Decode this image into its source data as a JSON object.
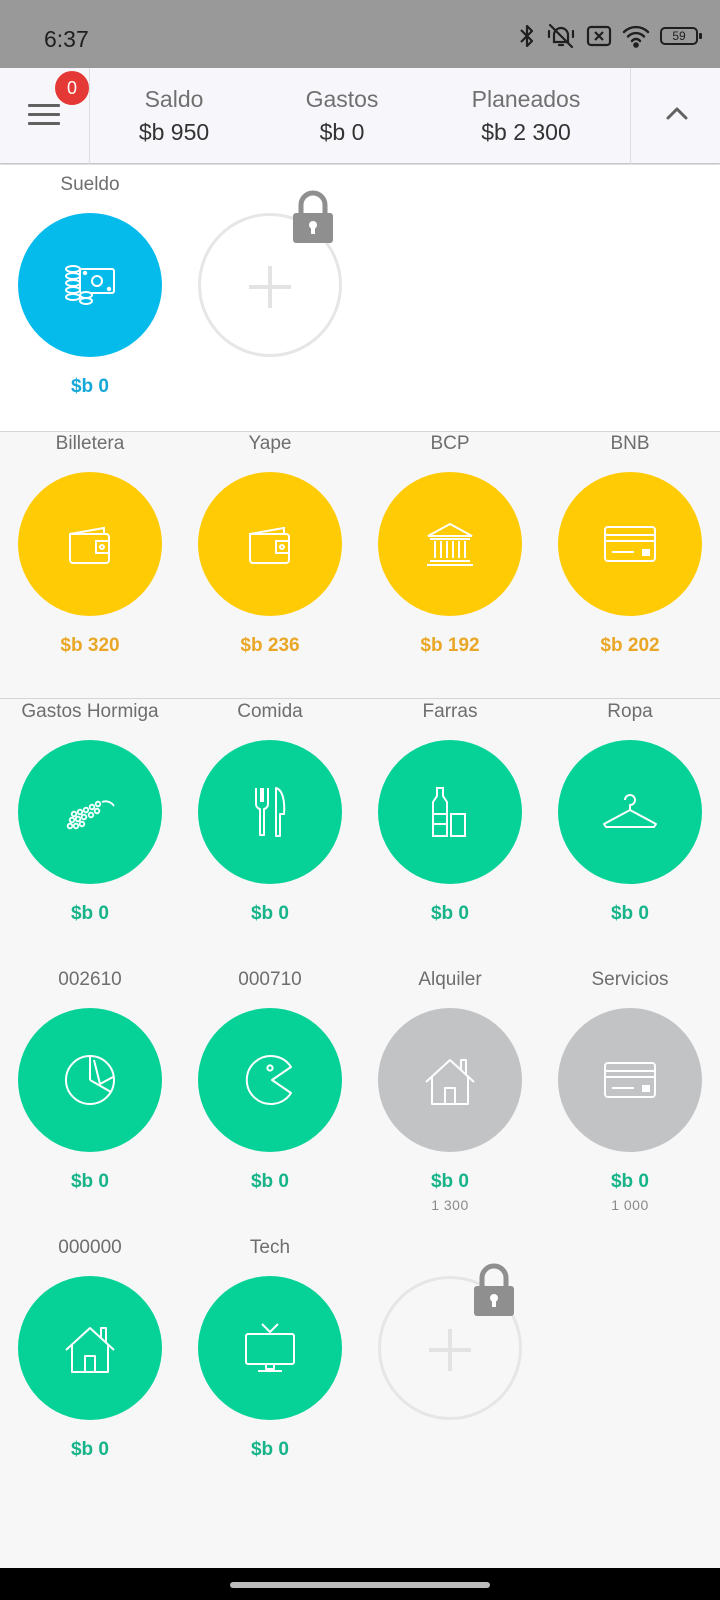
{
  "status_bar": {
    "time": "6:37",
    "battery": "59",
    "icons": [
      "bluetooth-icon",
      "mute-vibrate-icon",
      "no-sim-icon",
      "wifi-icon",
      "battery-icon"
    ]
  },
  "header": {
    "notification_count": "0",
    "saldo": {
      "label": "Saldo",
      "value": "$b 950"
    },
    "gastos": {
      "label": "Gastos",
      "value": "$b 0"
    },
    "planeados": {
      "label": "Planeados",
      "value": "$b 2 300"
    }
  },
  "income": [
    {
      "name": "Sueldo",
      "amount": "$b 0",
      "icon": "money-coins-icon",
      "color": "#05bbec"
    }
  ],
  "accounts": [
    {
      "name": "Billetera",
      "amount": "$b 320",
      "icon": "wallet-icon",
      "color": "#ffcb05"
    },
    {
      "name": "Yape",
      "amount": "$b 236",
      "icon": "wallet-icon",
      "color": "#ffcb05"
    },
    {
      "name": "BCP",
      "amount": "$b 192",
      "icon": "bank-icon",
      "color": "#ffcb05"
    },
    {
      "name": "BNB",
      "amount": "$b 202",
      "icon": "credit-card-icon",
      "color": "#ffcb05"
    }
  ],
  "expenses": [
    {
      "name": "Gastos Hormiga",
      "amount": "$b 0",
      "icon": "ants-icon"
    },
    {
      "name": "Comida",
      "amount": "$b 0",
      "icon": "fork-knife-icon"
    },
    {
      "name": "Farras",
      "amount": "$b 0",
      "icon": "bottle-glass-icon"
    },
    {
      "name": "Ropa",
      "amount": "$b 0",
      "icon": "hanger-icon"
    },
    {
      "name": "002610",
      "amount": "$b 0",
      "icon": "pie-chart-icon"
    },
    {
      "name": "000710",
      "amount": "$b 0",
      "icon": "pacman-icon"
    },
    {
      "name": "Alquiler",
      "amount": "$b 0",
      "planned": "1 300",
      "icon": "house-icon"
    },
    {
      "name": "Servicios",
      "amount": "$b 0",
      "planned": "1 000",
      "icon": "credit-card-icon"
    },
    {
      "name": "000000",
      "amount": "$b 0",
      "icon": "house-icon"
    },
    {
      "name": "Tech",
      "amount": "$b 0",
      "icon": "tv-icon"
    }
  ],
  "colors": {
    "income": "#05bbec",
    "account": "#ffcb05",
    "expense": "#06d298",
    "planned": "#c1c3c5"
  }
}
